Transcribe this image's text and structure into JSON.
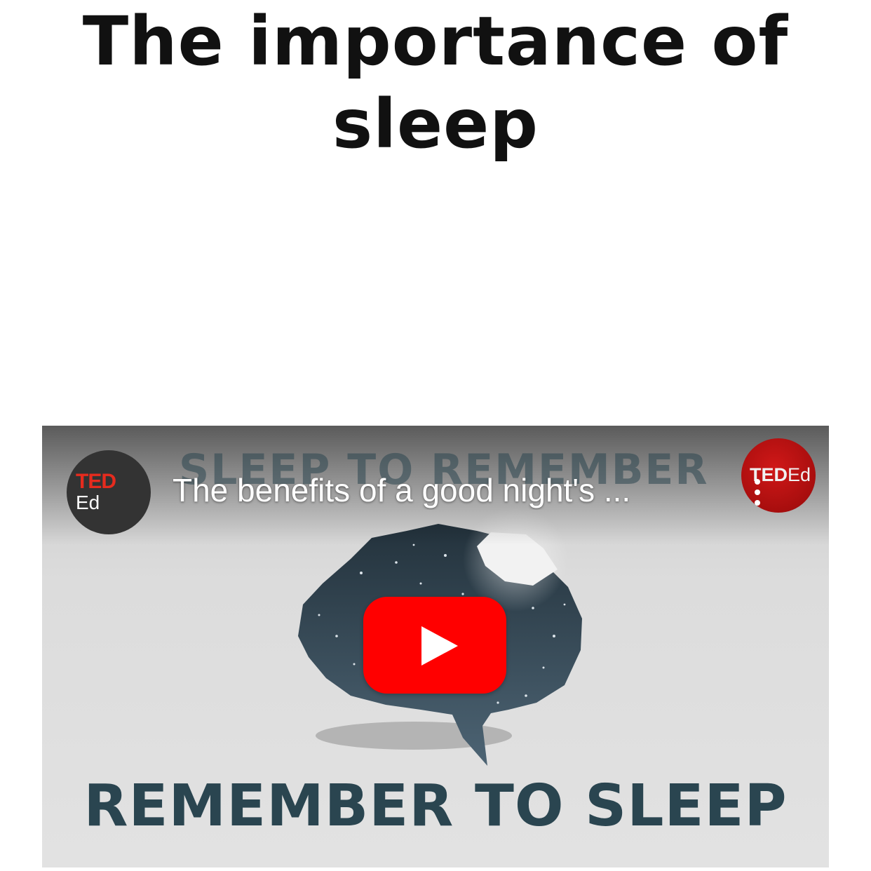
{
  "page": {
    "title": "The importance of sleep"
  },
  "video": {
    "title": "The benefits of a good night's ...",
    "channel_avatar": {
      "line1": "TED",
      "line2": "Ed"
    },
    "badge": {
      "bold": "TED",
      "regular": "Ed"
    },
    "thumbnail": {
      "top_text": "SLEEP TO REMEMBER",
      "bottom_text": "REMEMBER TO SLEEP"
    },
    "icons": {
      "play": "youtube-play-icon",
      "more": "more-vertical-icon"
    },
    "colors": {
      "play_button": "#ff0000",
      "ted_red": "#e62b1e",
      "banner_text": "#2a4550",
      "brain": "#3b5260"
    }
  }
}
